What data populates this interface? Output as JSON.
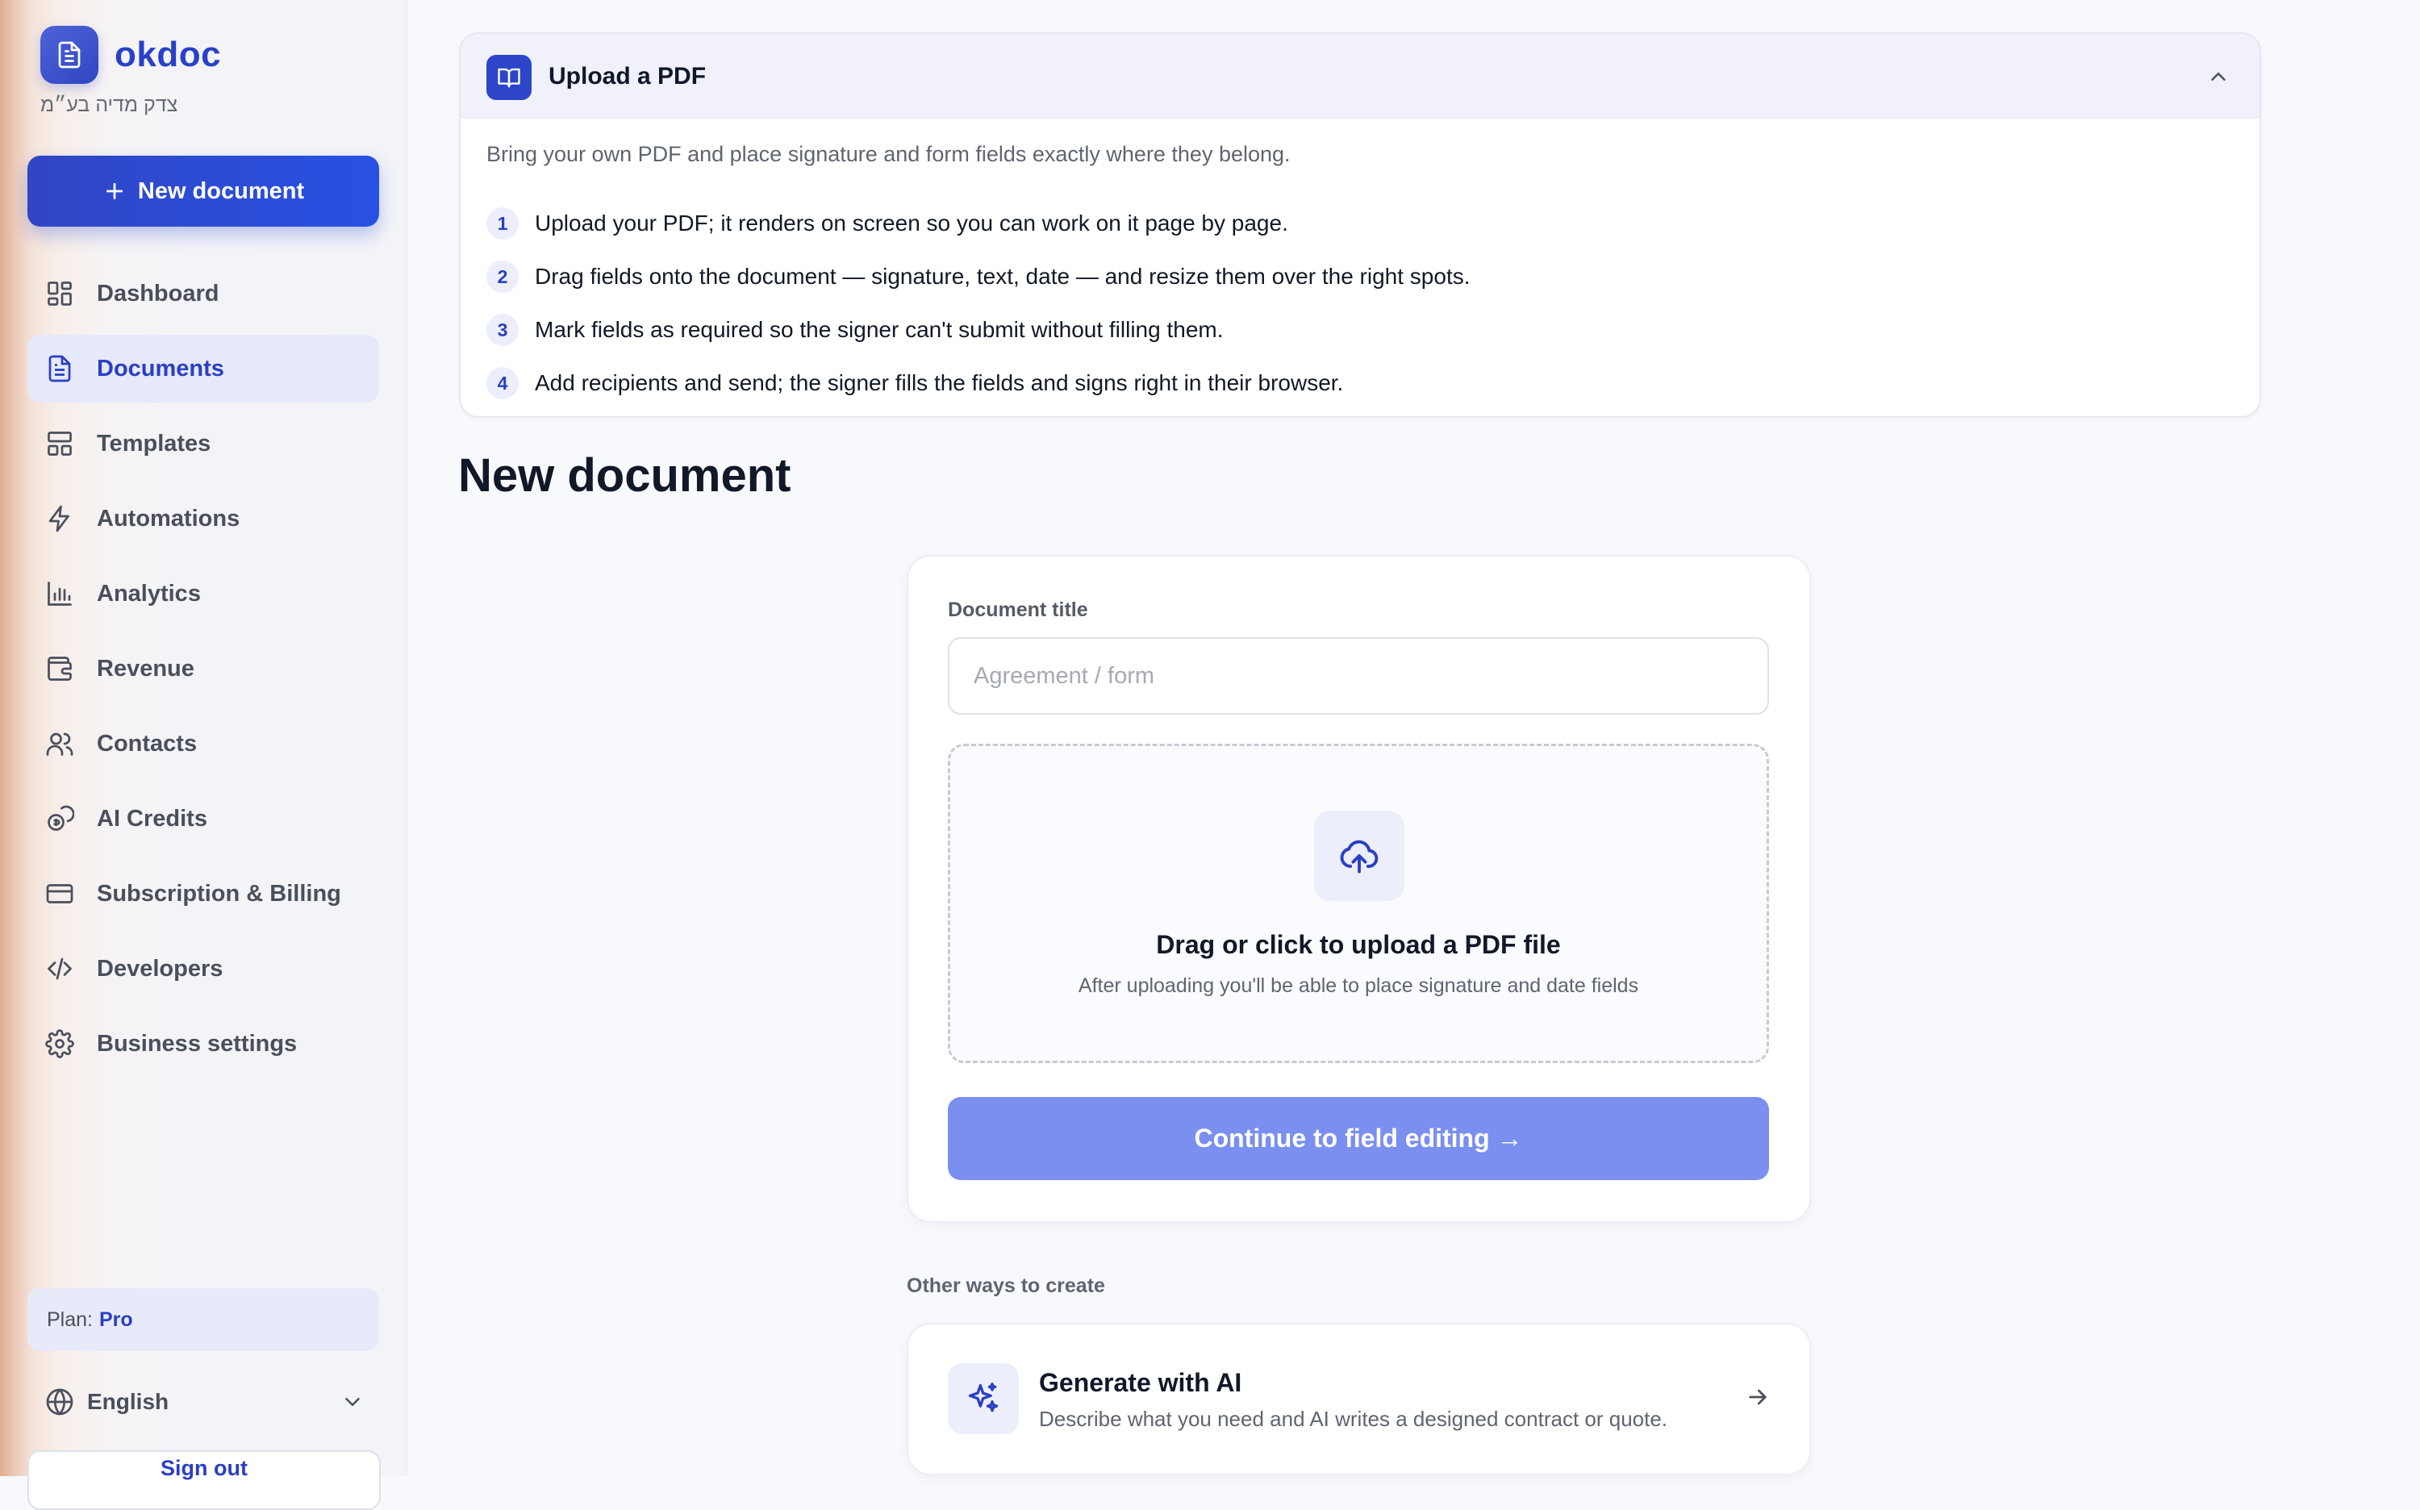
{
  "brand": {
    "name": "okdoc",
    "subtitle": "צדק מדיה בע״מ",
    "color": "#2941c9"
  },
  "sidebar": {
    "new_document_label": "New document",
    "items": [
      {
        "label": "Dashboard",
        "icon": "dashboard-icon",
        "active": false
      },
      {
        "label": "Documents",
        "icon": "document-icon",
        "active": true
      },
      {
        "label": "Templates",
        "icon": "templates-icon",
        "active": false
      },
      {
        "label": "Automations",
        "icon": "lightning-icon",
        "active": false
      },
      {
        "label": "Analytics",
        "icon": "bar-chart-icon",
        "active": false
      },
      {
        "label": "Revenue",
        "icon": "wallet-icon",
        "active": false
      },
      {
        "label": "Contacts",
        "icon": "users-icon",
        "active": false
      },
      {
        "label": "AI Credits",
        "icon": "coins-icon",
        "active": false
      },
      {
        "label": "Subscription & Billing",
        "icon": "credit-card-icon",
        "active": false
      },
      {
        "label": "Developers",
        "icon": "code-icon",
        "active": false
      },
      {
        "label": "Business settings",
        "icon": "gear-icon",
        "active": false
      }
    ],
    "plan_label": "Plan:",
    "plan_value": "Pro",
    "language": "English",
    "signout_partial": "Sign out"
  },
  "guide": {
    "title": "Upload a PDF",
    "description": "Bring your own PDF and place signature and form fields exactly where they belong.",
    "steps": [
      {
        "num": "1",
        "text": "Upload your PDF; it renders on screen so you can work on it page by page."
      },
      {
        "num": "2",
        "text": "Drag fields onto the document — signature, text, date — and resize them over the right spots."
      },
      {
        "num": "3",
        "text": "Mark fields as required so the signer can't submit without filling them."
      },
      {
        "num": "4",
        "text": "Add recipients and send; the signer fills the fields and signs right in their browser."
      }
    ]
  },
  "main": {
    "page_title": "New document",
    "form": {
      "title_label": "Document title",
      "title_placeholder": "Agreement / form",
      "title_value": "",
      "dropzone_title": "Drag or click to upload a PDF file",
      "dropzone_subtitle": "After uploading you'll be able to place signature and date fields",
      "continue_label": "Continue to field editing →"
    },
    "other_ways_label": "Other ways to create",
    "ai_option": {
      "title": "Generate with AI",
      "description": "Describe what you need and AI writes a designed contract or quote."
    }
  },
  "colors": {
    "accent": "#2a3fc4",
    "accent_light": "#e6e9fa",
    "continue_button": "#7b8ff0",
    "text_primary": "#111827",
    "text_muted": "#5f6471"
  }
}
